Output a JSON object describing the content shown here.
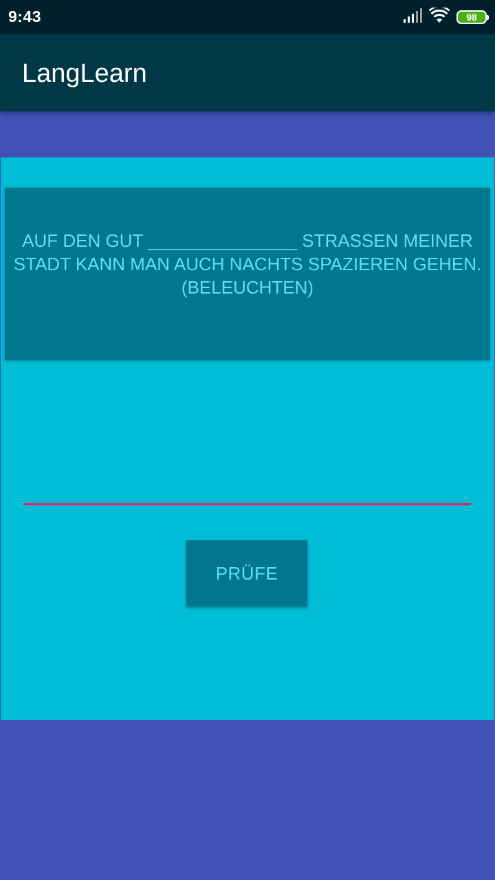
{
  "status_bar": {
    "time": "9:43",
    "icons": [
      "signal-icon",
      "wifi-icon",
      "battery-icon"
    ],
    "battery_level": "98"
  },
  "app_bar": {
    "title": "LangLearn"
  },
  "exercise": {
    "question": "AUF DEN GUT _______________ STRASSEN MEINER STADT KANN MAN AUCH NACHTS SPAZIEREN GEHEN. (BELEUCHTEN)",
    "answer_value": "",
    "answer_placeholder": "",
    "check_label": "PRÜFE"
  },
  "colors": {
    "status_bar": "#00212b",
    "app_bar": "#003848",
    "background": "#3f51b5",
    "card": "#00bcd4",
    "question_box": "#00778f",
    "text_accent": "#5ce3ef",
    "input_underline": "#e91e63",
    "battery": "#4caf1a"
  }
}
